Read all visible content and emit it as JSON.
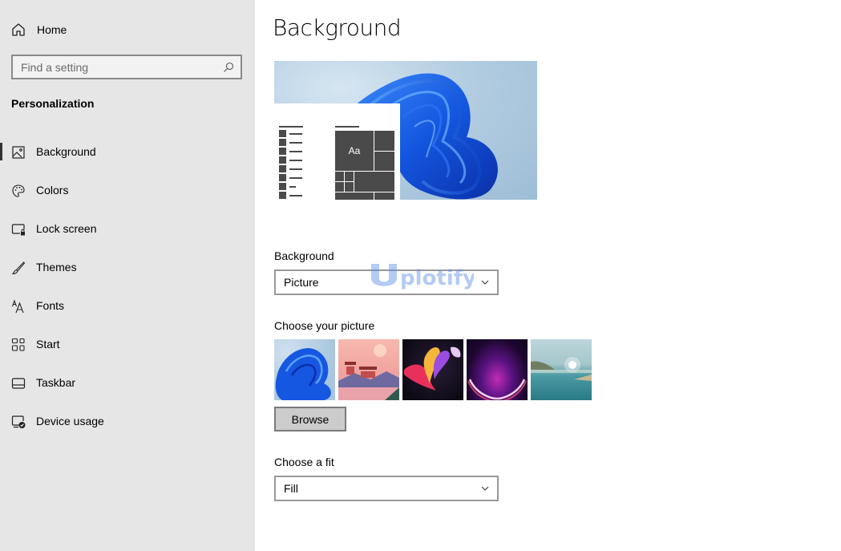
{
  "sidebar": {
    "home_label": "Home",
    "search_placeholder": "Find a setting",
    "section_title": "Personalization",
    "items": [
      {
        "label": "Background",
        "icon": "picture-icon",
        "active": true
      },
      {
        "label": "Colors",
        "icon": "palette-icon",
        "active": false
      },
      {
        "label": "Lock screen",
        "icon": "lock-screen-icon",
        "active": false
      },
      {
        "label": "Themes",
        "icon": "brush-icon",
        "active": false
      },
      {
        "label": "Fonts",
        "icon": "fonts-icon",
        "active": false
      },
      {
        "label": "Start",
        "icon": "start-grid-icon",
        "active": false
      },
      {
        "label": "Taskbar",
        "icon": "taskbar-icon",
        "active": false
      },
      {
        "label": "Device usage",
        "icon": "device-usage-icon",
        "active": false
      }
    ]
  },
  "main": {
    "title": "Background",
    "preview_tile_text": "Aa",
    "background_label": "Background",
    "background_value": "Picture",
    "choose_picture_label": "Choose your picture",
    "pictures": [
      {
        "name": "Windows bloom (blue)"
      },
      {
        "name": "Pagoda landscape"
      },
      {
        "name": "Abstract ribbons"
      },
      {
        "name": "Purple glow"
      },
      {
        "name": "Lake horizon"
      }
    ],
    "browse_label": "Browse",
    "fit_label": "Choose a fit",
    "fit_value": "Fill"
  },
  "watermark": {
    "text": "plotify"
  },
  "colors": {
    "sidebar_bg": "#e6e6e6",
    "accent_blue": "#1a5fe0",
    "tile_gray": "#4a4a4a"
  }
}
